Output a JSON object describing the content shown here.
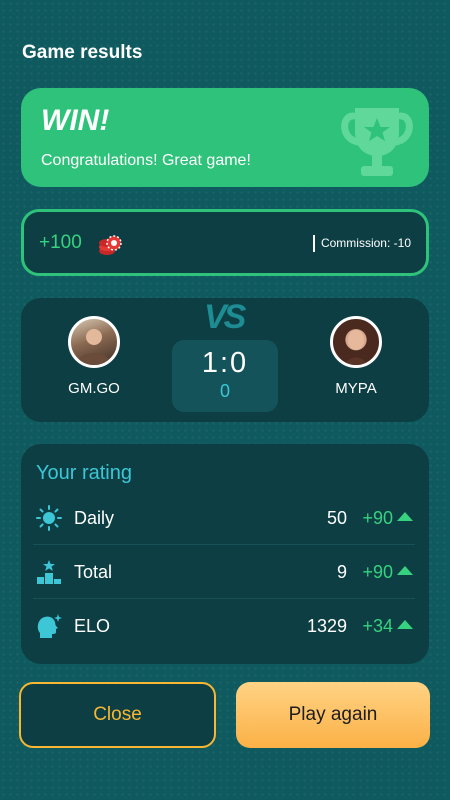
{
  "header": {
    "title": "Game results"
  },
  "result": {
    "title": "WIN!",
    "message": "Congratulations! Great game!",
    "icon": "trophy-icon"
  },
  "reward": {
    "amount": "+100",
    "currency_icon": "chips-icon",
    "commission": "Commission: -10"
  },
  "match": {
    "vs_label": "VS",
    "score": "1:0",
    "sub_score": "0",
    "player_left": {
      "name": "GM.GO",
      "avatar": "avatar-photo"
    },
    "player_right": {
      "name": "MYPA",
      "avatar": "avatar-photo"
    }
  },
  "rating": {
    "title": "Your rating",
    "rows": [
      {
        "label": "Daily",
        "value": "50",
        "delta": "+90",
        "icon": "sun-icon"
      },
      {
        "label": "Total",
        "value": "9",
        "delta": "+90",
        "icon": "podium-icon"
      },
      {
        "label": "ELO",
        "value": "1329",
        "delta": "+34",
        "icon": "head-sparkle-icon"
      }
    ]
  },
  "buttons": {
    "close_label": "Close",
    "play_again_label": "Play again"
  },
  "colors": {
    "background": "#0e5a5f",
    "card": "#0c3e43",
    "win_green": "#2ec27a",
    "accent_cyan": "#3cc6d6",
    "positive": "#37d27f",
    "gold": "#f7b733"
  }
}
